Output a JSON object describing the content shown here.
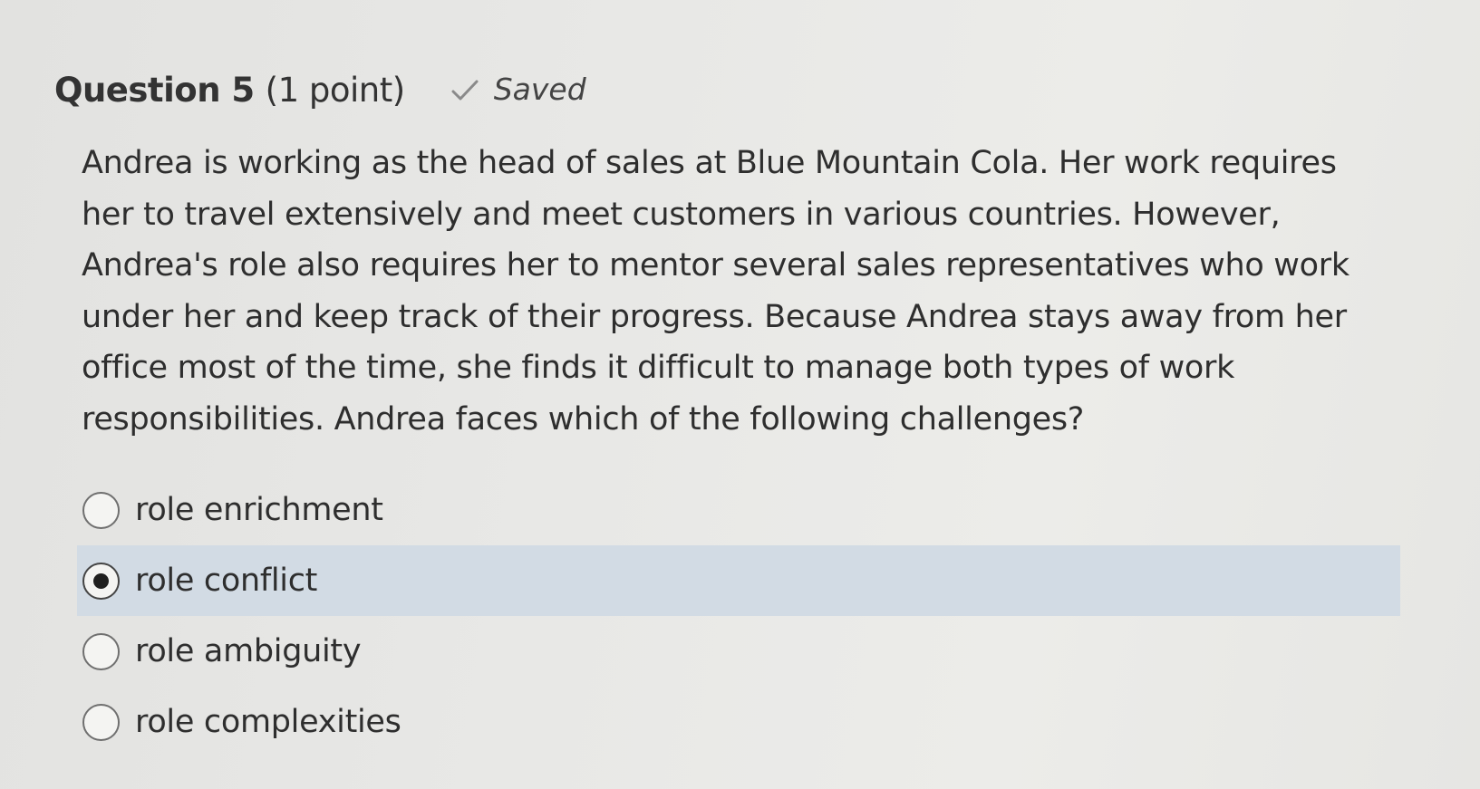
{
  "question": {
    "title": "Question 5",
    "points": "(1 point)",
    "status": "Saved",
    "status_icon": "checkmark-icon",
    "text": "Andrea is working as the head of sales at Blue Mountain Cola. Her work requires her to travel extensively and meet customers in various countries. However, Andrea's role also requires her to mentor several sales representatives who work under her and keep track of their progress. Because Andrea stays away from her office most of the time, she finds it difficult to manage both types of work responsibilities. Andrea faces which of the following challenges?"
  },
  "options": [
    {
      "label": "role enrichment",
      "selected": false
    },
    {
      "label": "role conflict",
      "selected": true
    },
    {
      "label": "role ambiguity",
      "selected": false
    },
    {
      "label": "role complexities",
      "selected": false
    }
  ],
  "colors": {
    "selected_row_bg": "#d2dbe4",
    "text": "#2e2e2e"
  }
}
